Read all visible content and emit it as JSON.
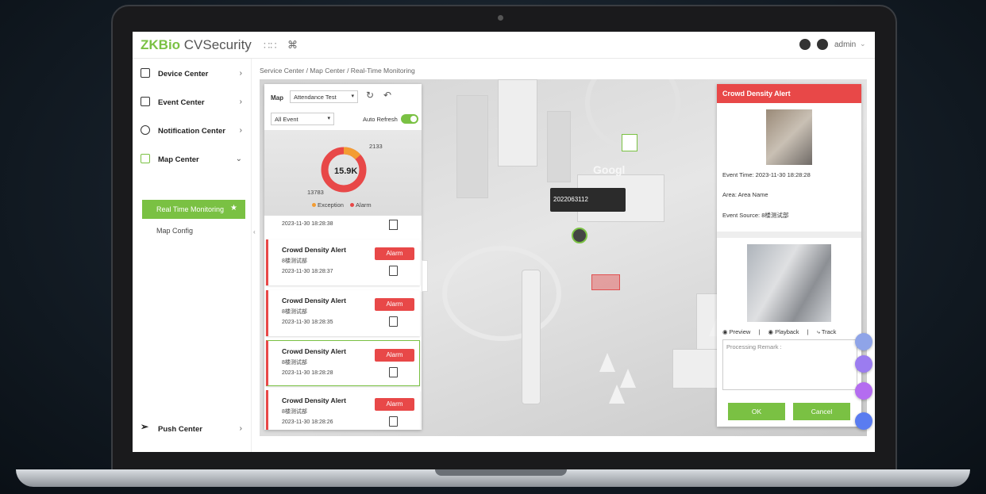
{
  "app": {
    "logo_zk": "ZKBio",
    "logo_cv": " CVSecurity",
    "user": "admin"
  },
  "sidebar": {
    "items": [
      {
        "label": "Device Center"
      },
      {
        "label": "Event Center"
      },
      {
        "label": "Notification Center"
      },
      {
        "label": "Map Center"
      },
      {
        "label": "Push Center"
      }
    ],
    "active_sub": "Real Time Monitoring",
    "sub": "Map Config"
  },
  "breadcrumb": "Service Center / Map Center / Real-Time Monitoring",
  "panel": {
    "map_label": "Map",
    "map_value": "Attendance Test",
    "event_filter": "All Event",
    "auto_refresh_label": "Auto Refresh",
    "auto_refresh_on": true,
    "donut": {
      "center": "15.9K",
      "top": "2133",
      "bottom": "13783",
      "legend_exception": "Exception",
      "legend_alarm": "Alarm",
      "exception_value": 2133,
      "alarm_value": 13783
    },
    "top_card_time": "2023-11-30 18:28:38",
    "cards": [
      {
        "title": "Crowd Density Alert",
        "source": "8楼测试部",
        "time": "2023-11-30 18:28:37",
        "btn": "Alarm"
      },
      {
        "title": "Crowd Density Alert",
        "source": "8楼测试部",
        "time": "2023-11-30 18:28:35",
        "btn": "Alarm"
      },
      {
        "title": "Crowd Density Alert",
        "source": "8楼测试部",
        "time": "2023-11-30 18:28:28",
        "btn": "Alarm"
      },
      {
        "title": "Crowd Density Alert",
        "source": "8楼测试部",
        "time": "2023-11-30 18:28:26",
        "btn": "Alarm"
      }
    ]
  },
  "map": {
    "tooltip": "2022063112",
    "sign": "Googl"
  },
  "alert": {
    "title": "Crowd Density Alert",
    "event_time": "Event Time: 2023-11-30 18:28:28",
    "area": "Area: Area Name",
    "event_source": "Event Source: 8楼测试部",
    "preview": "Preview",
    "playback": "Playback",
    "track": "Track",
    "remark_placeholder": "Processing Remark :",
    "ok": "OK",
    "cancel": "Cancel"
  }
}
